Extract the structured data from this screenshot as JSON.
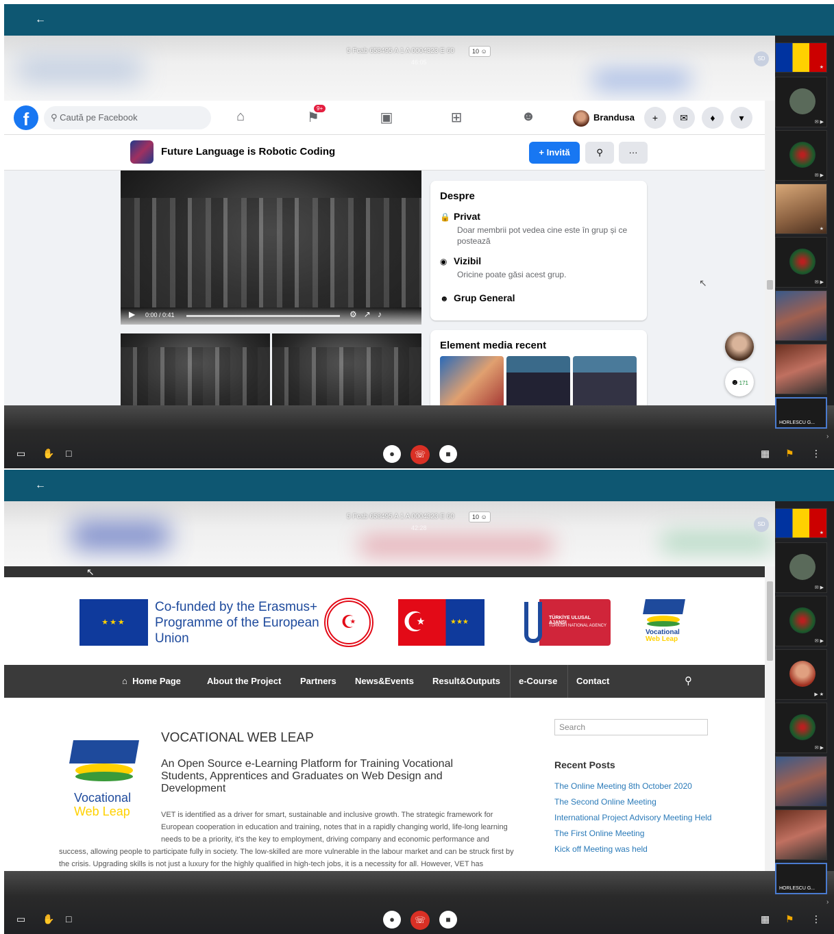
{
  "meeting": {
    "title": "5 Fcab 658495 A 1 A 0004323 E 60",
    "participants_badge": "10",
    "time_1": "46:05",
    "time_2": "42:28",
    "sd_initials": "SD",
    "bottom_participant": "HORLESCU G...",
    "accent": "#0e5772",
    "hangup_color": "#d93025"
  },
  "facebook": {
    "logo": "f",
    "search_placeholder": "Caută pe Facebook",
    "notif_badge": "9+",
    "user_name": "Brandusa",
    "group_title": "Future Language is Robotic Coding",
    "invite_label": "+ Invită",
    "more_label": "···",
    "video_time": "0:00 / 0:41",
    "about": {
      "heading": "Despre",
      "private_title": "Privat",
      "private_desc": "Doar membrii pot vedea cine este în grup și ce postează",
      "visible_title": "Vizibil",
      "visible_desc": "Oricine poate găsi acest grup.",
      "general": "Grup General"
    },
    "media_heading": "Element media recent",
    "contacts_count": "171"
  },
  "vwl": {
    "cofunded": "Co-funded by the Erasmus+ Programme of the European Union",
    "tna_line1": "TÜRKİYE ULUSAL AJANSI",
    "tna_line2": "TURKISH NATIONAL AGENCY",
    "logo_word1": "Vocational",
    "logo_word2": "Web Leap",
    "menu": [
      "Home Page",
      "About the Project",
      "Partners",
      "News&Events",
      "Result&Outputs",
      "e-Course",
      "Contact"
    ],
    "title": "VOCATIONAL WEB LEAP",
    "subtitle": "An Open Source e-Learning Platform for Training Vocational Students, Apprentices and Graduates on Web Design and Development",
    "para_a": "VET is identified as a driver for smart, sustainable and inclusive growth. The strategic framework for European cooperation in education and training, notes that in a rapidly changing world, life-long learning needs to be a priority, it's the key to employment, driving company and economic performance and",
    "para_b": "success, allowing people to participate fully in society. The low-skilled are more vulnerable in the labour market and can be struck first by the crisis. Upgrading skills is not just a luxury for the highly qualified in high-tech jobs, it is a necessity for all. However, VET has",
    "search_placeholder": "Search",
    "recent_posts_heading": "Recent Posts",
    "recent_posts": [
      "The Online Meeting 8th October 2020",
      "The Second Online Meeting",
      "International Project Advisory Meeting Held",
      "The First Online Meeting",
      "Kick off Meeting was held"
    ]
  }
}
